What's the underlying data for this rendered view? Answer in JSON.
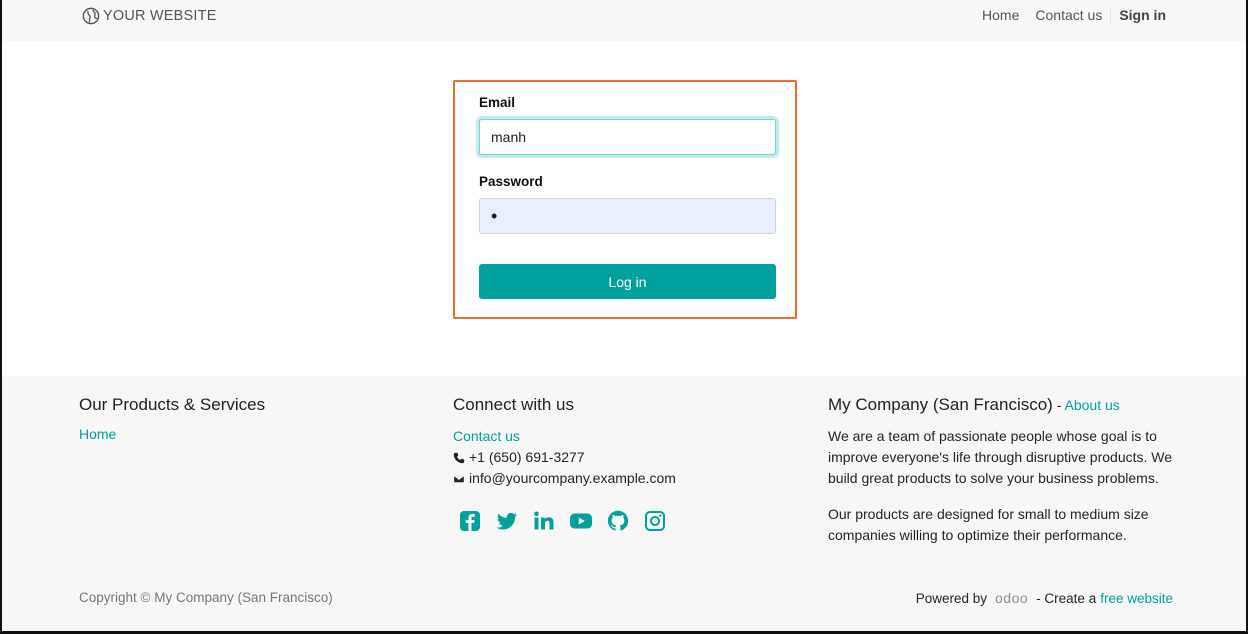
{
  "header": {
    "brand": "YOUR WEBSITE",
    "nav": [
      {
        "label": "Home"
      },
      {
        "label": "Contact us"
      }
    ],
    "signin": "Sign in"
  },
  "login": {
    "email_label": "Email",
    "email_value": "manh",
    "password_label": "Password",
    "password_value": "•",
    "login_button": "Log in"
  },
  "footer": {
    "products": {
      "heading": "Our Products & Services",
      "home_link": "Home"
    },
    "connect": {
      "heading": "Connect with us",
      "contact_link": "Contact us",
      "phone": "+1 (650) 691-3277",
      "email": "info@yourcompany.example.com",
      "socials": [
        "facebook-icon",
        "twitter-icon",
        "linkedin-icon",
        "youtube-icon",
        "github-icon",
        "instagram-icon"
      ]
    },
    "company": {
      "heading": "My Company (San Francisco)",
      "separator": " - ",
      "about_link": "About us",
      "para1": "We are a team of passionate people whose goal is to improve everyone's life through disruptive products. We build great products to solve your business problems.",
      "para2": "Our products are designed for small to medium size companies willing to optimize their performance."
    },
    "copyright": "Copyright © My Company (San Francisco)",
    "powered_prefix": "Powered by",
    "powered_brand": "odoo",
    "powered_middle": "- Create a",
    "powered_link": "free website"
  },
  "colors": {
    "accent": "#00a09d",
    "highlight_border": "#f26b2a",
    "footer_bg": "#f7f7f7",
    "header_bg": "#f8f8f8"
  }
}
